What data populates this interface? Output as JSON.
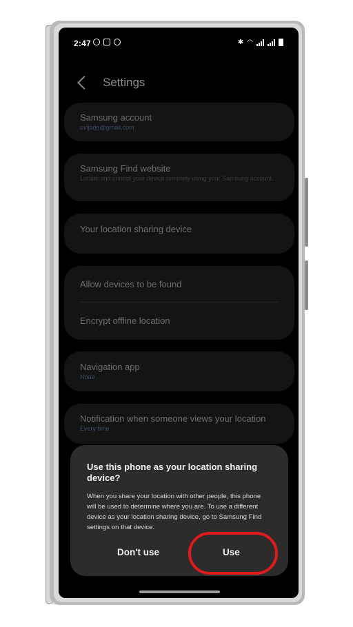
{
  "status": {
    "time": "2:47"
  },
  "header": {
    "title": "Settings"
  },
  "items": {
    "samsung_account": {
      "title": "Samsung account",
      "sub": "ovijade@gmail.com"
    },
    "find_website": {
      "title": "Samsung Find website",
      "sub": "Locate and control your device remotely using your Samsung account."
    },
    "location_sharing": {
      "title": "Your location sharing device"
    },
    "allow_found": {
      "title": "Allow devices to be found"
    },
    "encrypt": {
      "title": "Encrypt offline location"
    },
    "nav_app": {
      "title": "Navigation app",
      "sub": "None"
    },
    "notification": {
      "title": "Notification when someone views your location",
      "sub": "Every time"
    }
  },
  "dialog": {
    "title": "Use this phone as your location sharing device?",
    "body": "When you share your location with other people, this phone will be used to determine where you are. To use a different device as your location sharing device, go to Samsung Find settings on that device.",
    "cancel_label": "Don't use",
    "confirm_label": "Use"
  },
  "colors": {
    "annotation": "#e01b1b",
    "accent_sub": "#3c4a6a"
  }
}
